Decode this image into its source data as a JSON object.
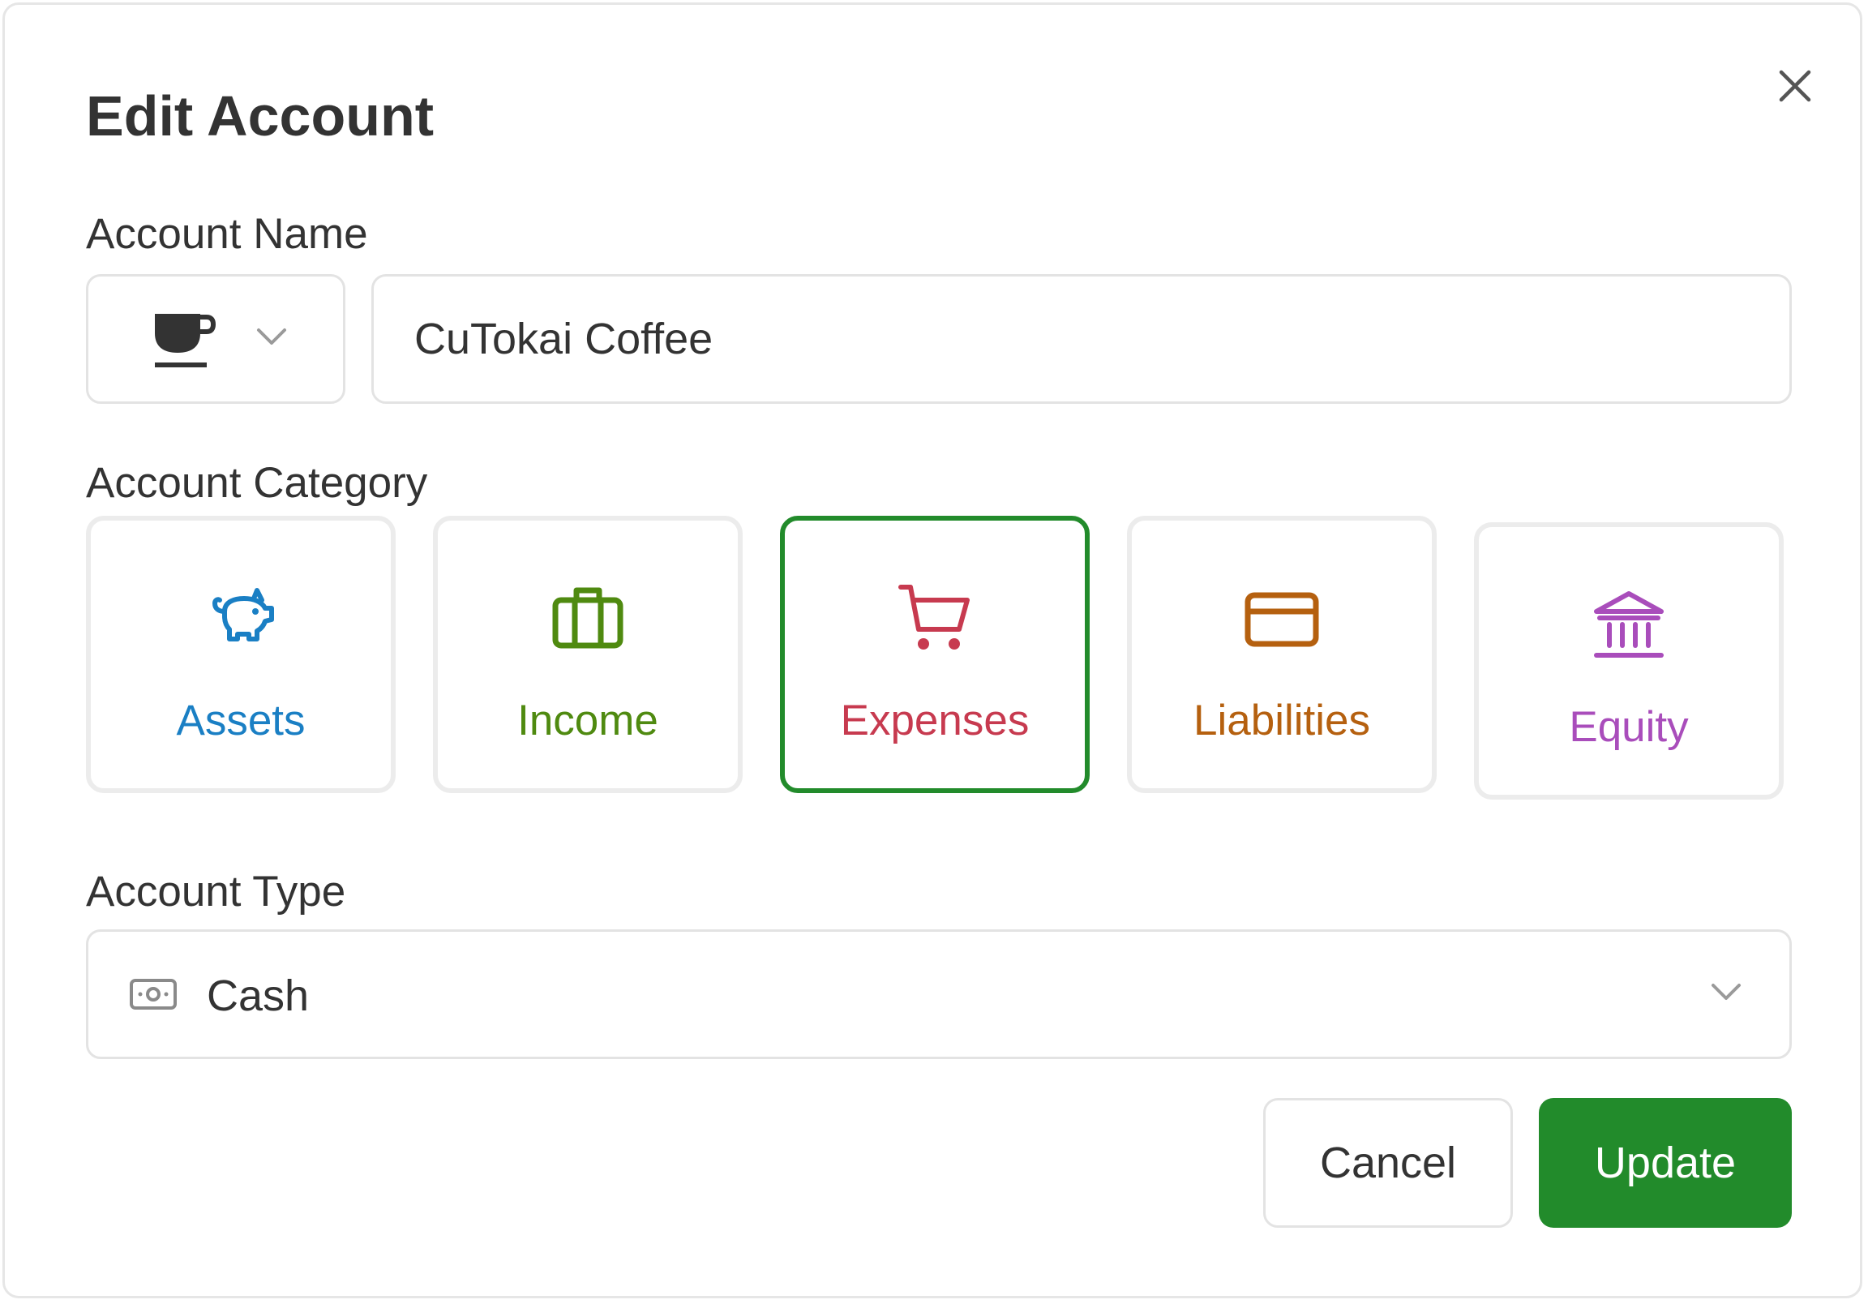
{
  "dialog": {
    "title": "Edit Account"
  },
  "account_name": {
    "label": "Account Name",
    "icon": "coffee-cup-icon",
    "value": "CuTokai Coffee"
  },
  "account_category": {
    "label": "Account Category",
    "selected": "Expenses",
    "items": [
      {
        "label": "Assets",
        "icon": "piggy-bank-icon",
        "color": "#1a7fc4"
      },
      {
        "label": "Income",
        "icon": "briefcase-icon",
        "color": "#4f8a10"
      },
      {
        "label": "Expenses",
        "icon": "shopping-cart-icon",
        "color": "#c73a4f"
      },
      {
        "label": "Liabilities",
        "icon": "credit-card-icon",
        "color": "#b5600f"
      },
      {
        "label": "Equity",
        "icon": "bank-icon",
        "color": "#a94dbb"
      }
    ]
  },
  "account_type": {
    "label": "Account Type",
    "icon": "cash-icon",
    "value": "Cash"
  },
  "actions": {
    "cancel_label": "Cancel",
    "update_label": "Update"
  },
  "colors": {
    "primary": "#228b2b",
    "text": "#333333",
    "border": "#e3e3e3"
  }
}
